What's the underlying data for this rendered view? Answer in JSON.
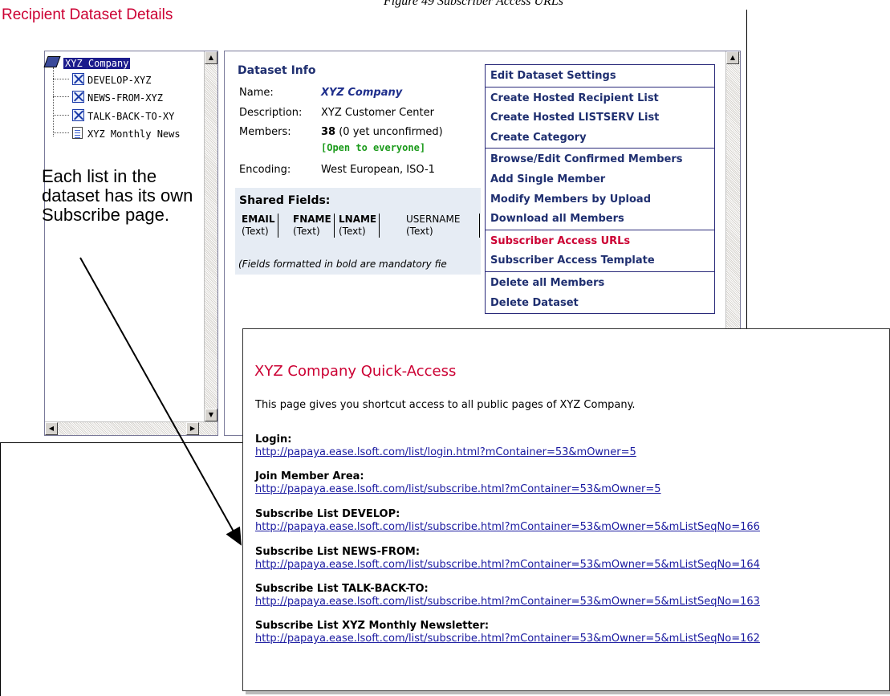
{
  "caption": "Figure 49 Subscriber Access URLs",
  "page_title": "Recipient Dataset Details",
  "tree": {
    "root": "XYZ Company",
    "items": [
      {
        "label": "DEVELOP-XYZ",
        "icon": "list-x-icon"
      },
      {
        "label": "NEWS-FROM-XYZ",
        "icon": "list-x-icon"
      },
      {
        "label": "TALK-BACK-TO-XY",
        "icon": "list-x-icon"
      },
      {
        "label": "XYZ Monthly News",
        "icon": "newsletter-doc-icon"
      }
    ]
  },
  "annotation": "Each list in the dataset has its own Subscribe page.",
  "dataset_info": {
    "title": "Dataset Info",
    "name_label": "Name:",
    "name_value": "XYZ Company",
    "description_label": "Description:",
    "description_value": "XYZ Customer Center",
    "members_label": "Members:",
    "members_count": "38",
    "members_note": "(0 yet unconfirmed)",
    "open_note": "[Open to everyone]",
    "encoding_label": "Encoding:",
    "encoding_value": "West European, ISO-1"
  },
  "shared_fields": {
    "title": "Shared Fields:",
    "fields": [
      {
        "name": "EMAIL",
        "type": "(Text)",
        "mandatory": true
      },
      {
        "name": "FNAME",
        "type": "(Text)",
        "mandatory": true
      },
      {
        "name": "LNAME",
        "type": "(Text)",
        "mandatory": true
      },
      {
        "name": "USERNAME",
        "type": "(Text)",
        "mandatory": false
      }
    ],
    "note": "(Fields formatted in bold are mandatory fie"
  },
  "menu": {
    "groups": [
      [
        "Edit Dataset Settings"
      ],
      [
        "Create Hosted Recipient List",
        "Create Hosted LISTSERV List",
        "Create Category"
      ],
      [
        "Browse/Edit Confirmed Members",
        "Add Single Member",
        "Modify Members by Upload",
        "Download all Members"
      ],
      [
        "Subscriber Access URLs",
        "Subscriber Access Template"
      ],
      [
        "Delete all Members",
        "Delete Dataset"
      ]
    ],
    "active": "Subscriber Access URLs"
  },
  "quick_access": {
    "title": "XYZ Company Quick-Access",
    "intro": "This page gives you shortcut access to all public pages of XYZ Company.",
    "entries": [
      {
        "heading": "Login:",
        "url": "http://papaya.ease.lsoft.com/list/login.html?mContainer=53&mOwner=5"
      },
      {
        "heading": "Join Member Area:",
        "url": "http://papaya.ease.lsoft.com/list/subscribe.html?mContainer=53&mOwner=5"
      },
      {
        "heading": "Subscribe List DEVELOP:",
        "url": "http://papaya.ease.lsoft.com/list/subscribe.html?mContainer=53&mOwner=5&mListSeqNo=166"
      },
      {
        "heading": "Subscribe List NEWS-FROM:",
        "url": "http://papaya.ease.lsoft.com/list/subscribe.html?mContainer=53&mOwner=5&mListSeqNo=164"
      },
      {
        "heading": "Subscribe List TALK-BACK-TO:",
        "url": "http://papaya.ease.lsoft.com/list/subscribe.html?mContainer=53&mOwner=5&mListSeqNo=163"
      },
      {
        "heading": "Subscribe List XYZ Monthly Newsletter:",
        "url": "http://papaya.ease.lsoft.com/list/subscribe.html?mContainer=53&mOwner=5&mListSeqNo=162"
      }
    ]
  },
  "colors": {
    "title_red": "#cc0033",
    "menu_blue": "#1f2f70",
    "link_blue": "#1a1aa0",
    "open_green": "#1a9a1a",
    "selection_navy": "#1c1c8c"
  }
}
